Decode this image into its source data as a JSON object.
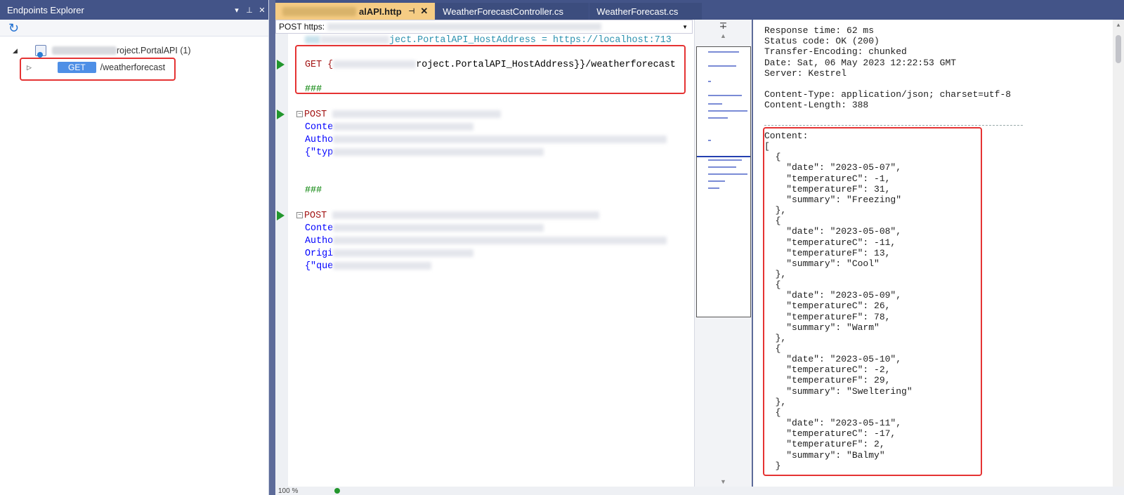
{
  "left_panel": {
    "title": "Endpoints Explorer",
    "refresh_icon": "refresh-icon",
    "project_suffix": "roject.PortalAPI (1)",
    "endpoint_method": "GET",
    "endpoint_path": "/weatherforecast"
  },
  "tabs": [
    {
      "label": "alAPI.http",
      "active": true
    },
    {
      "label": "WeatherForecastController.cs",
      "active": false
    },
    {
      "label": "WeatherForecast.cs",
      "active": false
    }
  ],
  "editor": {
    "request_dropdown": "POST https:",
    "line_var": "ject.PortalAPI_HostAddress = https://localhost:713",
    "line_get_prefix": "GET {",
    "line_get_suffix": "roject.PortalAPI_HostAddress}}/weatherforecast",
    "separator": "###",
    "post1": {
      "method": "POST",
      "h1": "Conte",
      "h2": "Autho",
      "body": "{\"typ"
    },
    "post2": {
      "method": "POST",
      "h1": "Conte",
      "h2": "Autho",
      "h3": "Origi",
      "body": "{\"que"
    }
  },
  "response": {
    "headers": [
      "Response time: 62 ms",
      "Status code: OK (200)",
      "Transfer-Encoding: chunked",
      "Date: Sat, 06 May 2023 12:22:53 GMT",
      "Server: Kestrel",
      "",
      "Content-Type: application/json; charset=utf-8",
      "Content-Length: 388"
    ],
    "content_lines": [
      "Content:",
      "[",
      "  {",
      "    \"date\": \"2023-05-07\",",
      "    \"temperatureC\": -1,",
      "    \"temperatureF\": 31,",
      "    \"summary\": \"Freezing\"",
      "  },",
      "  {",
      "    \"date\": \"2023-05-08\",",
      "    \"temperatureC\": -11,",
      "    \"temperatureF\": 13,",
      "    \"summary\": \"Cool\"",
      "  },",
      "  {",
      "    \"date\": \"2023-05-09\",",
      "    \"temperatureC\": 26,",
      "    \"temperatureF\": 78,",
      "    \"summary\": \"Warm\"",
      "  },",
      "  {",
      "    \"date\": \"2023-05-10\",",
      "    \"temperatureC\": -2,",
      "    \"temperatureF\": 29,",
      "    \"summary\": \"Sweltering\"",
      "  },",
      "  {",
      "    \"date\": \"2023-05-11\",",
      "    \"temperatureC\": -17,",
      "    \"temperatureF\": 2,",
      "    \"summary\": \"Balmy\"",
      "  }"
    ]
  },
  "status": {
    "zoom": "100 %"
  },
  "colors": {
    "title_bar": "#435488",
    "active_tab": "#f5cc84",
    "get_badge": "#4e8fe6",
    "highlight_box": "#e53333",
    "run_arrow": "#22962d"
  }
}
